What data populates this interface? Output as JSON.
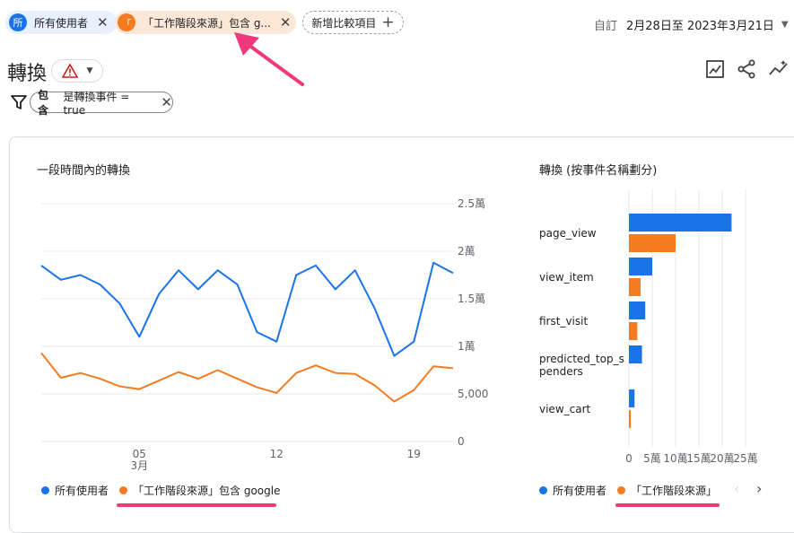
{
  "header": {
    "segment_all": {
      "avatar": "所",
      "label": "所有使用者"
    },
    "segment_custom": {
      "avatar": "「",
      "label": "「工作階段來源」包含 g..."
    },
    "add_compare_label": "新增比較項目",
    "date_prefix": "自訂",
    "date_range": "2月28日至 2023年3月21日"
  },
  "page": {
    "title": "轉換",
    "filter_chip": {
      "bold": "包含",
      "text": "是轉換事件 = true"
    }
  },
  "colors": {
    "blue": "#1a73e8",
    "orange": "#f47b20",
    "pink": "#f0397a",
    "warning": "#c5221f"
  },
  "icons": [
    "warning-icon",
    "dropdown-icon",
    "filter-icon",
    "edit-report-icon",
    "share-icon",
    "insights-icon",
    "close-icon",
    "plus-icon"
  ],
  "line_card": {
    "title": "一段時間內的轉換",
    "legend": [
      "所有使用者",
      "「工作階段來源」包含 google"
    ]
  },
  "bar_card": {
    "title": "轉換 (按事件名稱劃分)",
    "legend": [
      "所有使用者",
      "「工作階段來源」"
    ]
  },
  "chart_data": [
    {
      "type": "line",
      "title": "一段時間內的轉換",
      "y_ticks": [
        "2.5萬",
        "2萬",
        "1.5萬",
        "1萬",
        "5,000",
        "0"
      ],
      "x_ticks": [
        "05",
        "12",
        "19"
      ],
      "x_month_label": "3月",
      "ylim": [
        0,
        25000
      ],
      "x": [
        "02-28",
        "03-01",
        "03-02",
        "03-03",
        "03-04",
        "03-05",
        "03-06",
        "03-07",
        "03-08",
        "03-09",
        "03-10",
        "03-11",
        "03-12",
        "03-13",
        "03-14",
        "03-15",
        "03-16",
        "03-17",
        "03-18",
        "03-19",
        "03-20",
        "03-21"
      ],
      "series": [
        {
          "name": "所有使用者",
          "values": [
            18500,
            17000,
            17500,
            16500,
            14500,
            11000,
            15500,
            18000,
            16000,
            18000,
            16500,
            11500,
            10500,
            17500,
            18500,
            16000,
            18000,
            14000,
            9000,
            10500,
            18800,
            17700
          ]
        },
        {
          "name": "「工作階段來源」包含 google",
          "values": [
            9300,
            6700,
            7200,
            6600,
            5800,
            5500,
            6400,
            7300,
            6600,
            7500,
            6600,
            5700,
            5100,
            7200,
            8000,
            7200,
            7100,
            5900,
            4200,
            5400,
            7900,
            7700
          ]
        }
      ],
      "grid": true
    },
    {
      "type": "bar",
      "title": "轉換 (按事件名稱劃分)",
      "categories": [
        "page_view",
        "view_item",
        "first_visit",
        "predicted_top_spenders",
        "view_cart"
      ],
      "category_labels": [
        [
          "page_view"
        ],
        [
          "view_item"
        ],
        [
          "first_visit"
        ],
        [
          "predicted_top_s",
          "penders"
        ],
        [
          "view_cart"
        ]
      ],
      "x_ticks": [
        "0",
        "5萬",
        "10萬",
        "15萬",
        "20萬",
        "25萬"
      ],
      "xlim": [
        0,
        250000
      ],
      "series": [
        {
          "name": "所有使用者",
          "values": [
            220000,
            50000,
            35000,
            28000,
            12000
          ]
        },
        {
          "name": "「工作階段來源」",
          "values": [
            100000,
            25000,
            18000,
            0,
            4000
          ]
        }
      ],
      "grid": true
    }
  ]
}
